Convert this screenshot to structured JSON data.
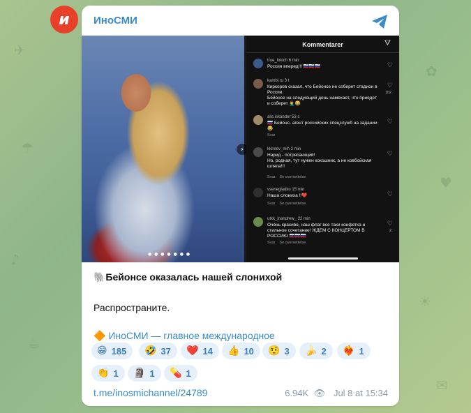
{
  "channel": {
    "avatar_letter": "и",
    "name": "ИноСМИ",
    "brand_color": "#e8412a",
    "link_color": "#3a8bc8"
  },
  "media": {
    "comments_header": "Kommentarer",
    "comments": [
      {
        "user": "true_lokich",
        "time": "6 min",
        "text": "Россия вперед!!! 🇷🇺🇷🇺🇷🇺",
        "meta": "",
        "count": ""
      },
      {
        "user": "kambi.ru",
        "time": "3 t",
        "text": "Киркоров сказал, что Бейонсе не соберет стадион в России.\nБейонсе на следующий день намекает, что приедет и соберет 🤦‍♂️😂",
        "meta": "",
        "count": "102"
      },
      {
        "user": "alis.iskander",
        "time": "53 s",
        "text": "🇷🇺 Бейонс- агент российских спецслужб на задании 😂",
        "meta": "Svar",
        "count": ""
      },
      {
        "user": "kkireev_mih",
        "time": "2 min",
        "text": "Нарид - потрясающий!\nНо, родная, тут нужен кокошник, а не ковбойская шляпа!!!",
        "meta": "Svar    Se oversettelse",
        "count": ""
      },
      {
        "user": "vsenegladko",
        "time": "15 min",
        "text": "Наша слониха !!❤️",
        "meta": "Svar    Se oversettelse",
        "count": ""
      },
      {
        "user": "utkk_inandrew_",
        "time": "22 min",
        "text": "Очень красиво, наш флаг все таки конфетка и стильное сочетание! ЖДЕМ С КОНЦЕРТОМ В РОССИЮ 🇷🇺🇷🇺🇷🇺",
        "meta": "Svar    Se oversettelse",
        "count": "2"
      }
    ]
  },
  "post": {
    "title": "🐘Бейонсе оказалась нашей слонихой",
    "body": "Распространите.",
    "link_text": "🔶 ИноСМИ — главное международное"
  },
  "reactions": [
    {
      "emoji": "😁",
      "count": "185"
    },
    {
      "emoji": "🤣",
      "count": "37"
    },
    {
      "emoji": "❤️",
      "count": "14"
    },
    {
      "emoji": "👍",
      "count": "10"
    },
    {
      "emoji": "🤨",
      "count": "3"
    },
    {
      "emoji": "🍌",
      "count": "2"
    },
    {
      "emoji": "❤️‍🔥",
      "count": "1"
    },
    {
      "emoji": "👏",
      "count": "1"
    },
    {
      "emoji": "🗿",
      "count": "1"
    },
    {
      "emoji": "💊",
      "count": "1"
    }
  ],
  "footer": {
    "link": "t.me/inosmichannel/24789",
    "views": "6.94K",
    "date": "Jul 8 at 15:34"
  }
}
